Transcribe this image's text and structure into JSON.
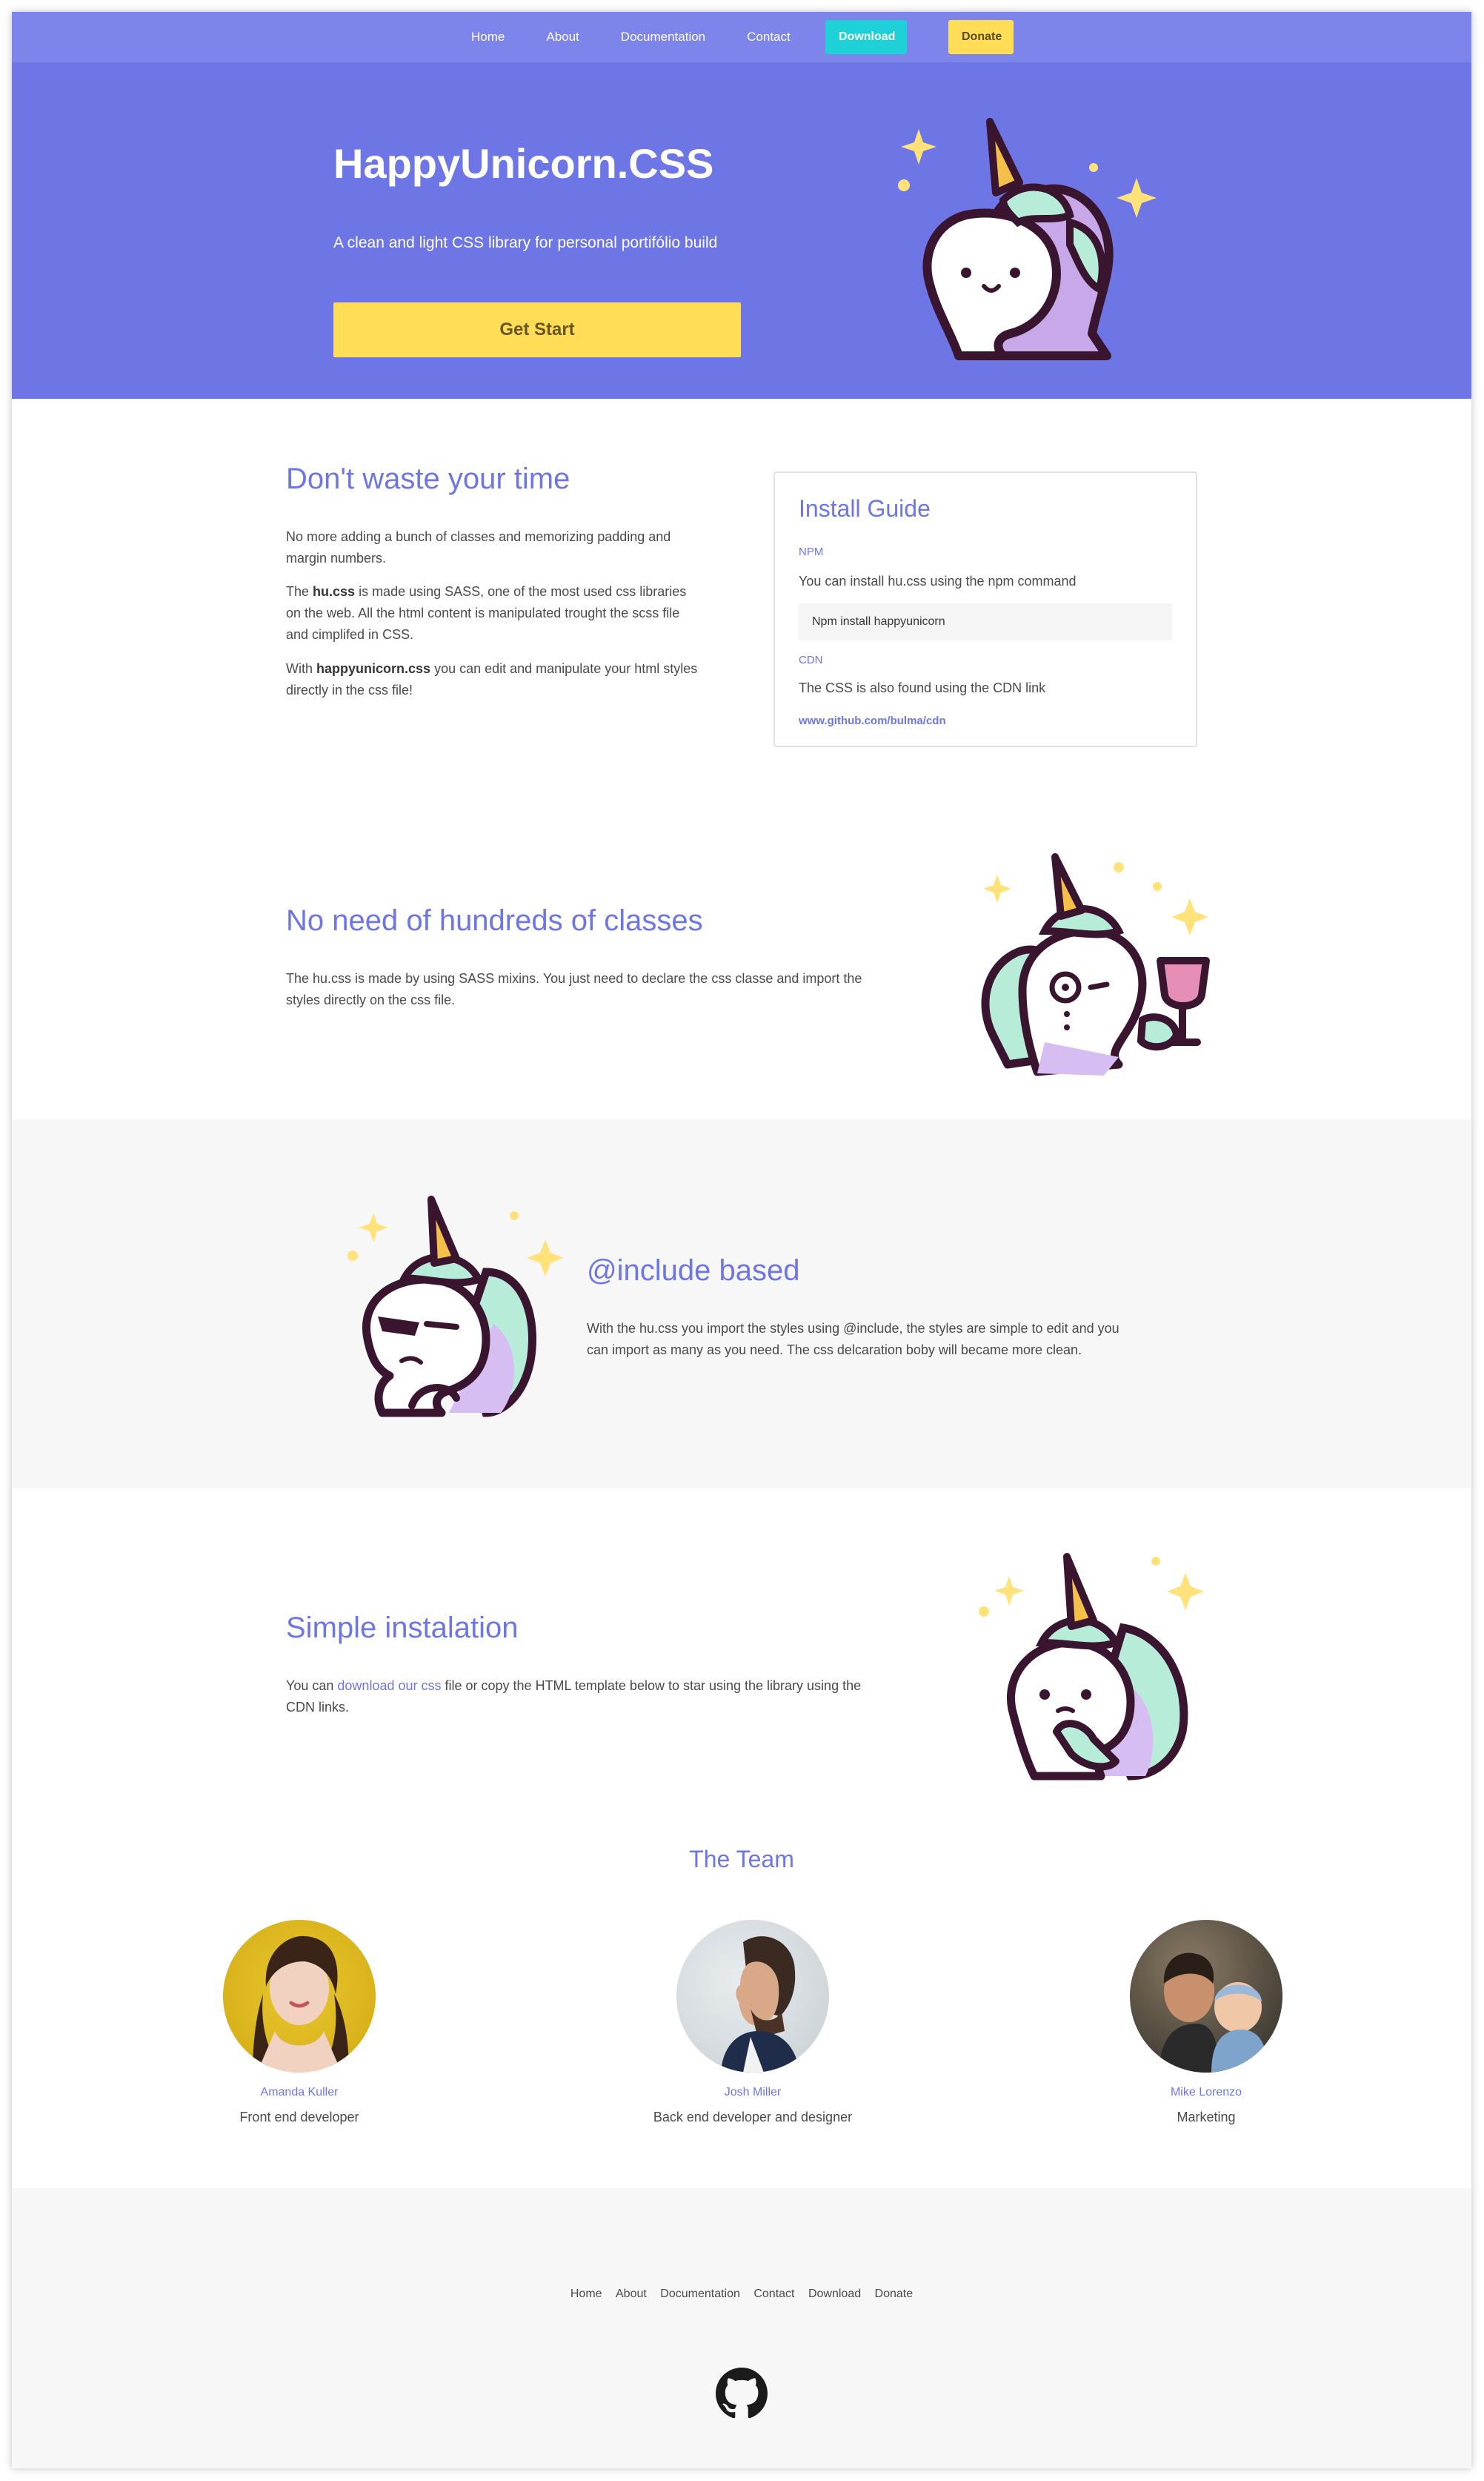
{
  "nav": {
    "links": [
      "Home",
      "About",
      "Documentation",
      "Contact"
    ],
    "download": "Download",
    "donate": "Donate"
  },
  "hero": {
    "title": "HappyUnicorn.CSS",
    "subtitle": "A clean and light CSS library for personal portifólio build",
    "cta": "Get Start"
  },
  "section1": {
    "title": "Don't waste your time",
    "p1": "No more adding a bunch of classes and memorizing padding and margin numbers.",
    "p2_pre": "The ",
    "p2_bold": "hu.css",
    "p2_post": " is made using SASS, one of the most used css libraries on the web. All the html content is manipulated trought the scss file and cimplifed in CSS.",
    "p3_pre": "With ",
    "p3_bold": "happyunicorn.css",
    "p3_post": " you can edit and manipulate your html styles directly in the css file!"
  },
  "install": {
    "title": "Install Guide",
    "npm_label": "NPM",
    "npm_text": "You can install hu.css using the npm command",
    "npm_code": "Npm install happyunicorn",
    "cdn_label": "CDN",
    "cdn_text": "The CSS is also found using the CDN link",
    "cdn_url": "www.github.com/bulma/cdn"
  },
  "section2": {
    "title": "No need of hundreds of classes",
    "text": "The hu.css is made by using SASS mixins. You just need to declare the css classe and import the styles directly on the css file."
  },
  "section3": {
    "title": "@include based",
    "text": "With the hu.css you import the styles using @include, the styles are simple to edit and you can import as many as you need. The css delcaration boby will became more clean."
  },
  "section4": {
    "title": "Simple instalation",
    "text_pre": "You can ",
    "text_link": "download our css",
    "text_post": " file or copy the HTML template below to star using the library using the CDN links."
  },
  "team": {
    "title": "The Team",
    "members": [
      {
        "name": "Amanda Kuller",
        "role": "Front end developer"
      },
      {
        "name": "Josh Miller",
        "role": "Back end developer and designer"
      },
      {
        "name": "Mike Lorenzo",
        "role": "Marketing"
      }
    ]
  },
  "footer": {
    "links": [
      "Home",
      "About",
      "Documentation",
      "Contact",
      "Download",
      "Donate"
    ]
  },
  "colors": {
    "primary": "#6e76e5",
    "nav": "#7d84ea",
    "yellow": "#ffdd57",
    "turquoise": "#1ed0d8"
  },
  "icons": [
    "unicorn-illustration",
    "github-icon"
  ]
}
